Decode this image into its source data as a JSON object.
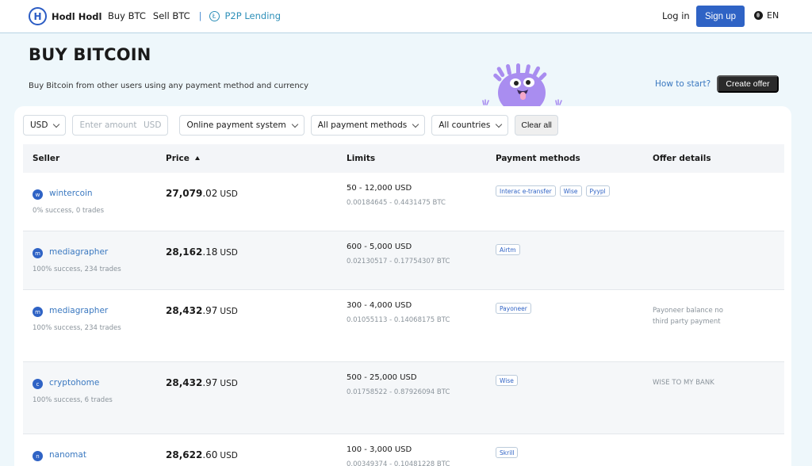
{
  "header": {
    "logo_text": "Hodl Hodl",
    "logo_letter": "H",
    "nav": [
      "Buy BTC",
      "Sell BTC"
    ],
    "separator": "|",
    "p2p_label": "P2P Lending",
    "p2p_icon_glyph": "Ł",
    "login": "Log in",
    "signup": "Sign up",
    "language": "EN"
  },
  "hero": {
    "title": "BUY BITCOIN",
    "subtitle": "Buy Bitcoin from other users using any payment method and currency",
    "how_to_start": "How to start?",
    "create_offer": "Create offer"
  },
  "filters": {
    "currency": "USD",
    "amount_placeholder": "Enter amount",
    "amount_currency": "USD",
    "payment_system": "Online payment system",
    "payment_methods": "All payment methods",
    "countries": "All countries",
    "clear": "Clear all"
  },
  "table": {
    "headers": {
      "seller": "Seller",
      "price": "Price",
      "limits": "Limits",
      "payment_methods": "Payment methods",
      "offer_details": "Offer details"
    },
    "rows": [
      {
        "avatar": "w",
        "seller": "wintercoin",
        "stats": "0% success, 0 trades",
        "price_int": "27,079",
        "price_dec": ".02",
        "currency": "USD",
        "limits": "50 - 12,000 USD",
        "btc": "0.00184645 - 0.4431475 BTC",
        "methods": [
          "Interac e-transfer",
          "Wise",
          "Pyypl"
        ],
        "details": ""
      },
      {
        "avatar": "m",
        "seller": "mediagrapher",
        "stats": "100% success, 234 trades",
        "price_int": "28,162",
        "price_dec": ".18",
        "currency": "USD",
        "limits": "600 - 5,000 USD",
        "btc": "0.02130517 - 0.17754307 BTC",
        "methods": [
          "Airtm"
        ],
        "details": ""
      },
      {
        "avatar": "m",
        "seller": "mediagrapher",
        "stats": "100% success, 234 trades",
        "price_int": "28,432",
        "price_dec": ".97",
        "currency": "USD",
        "limits": "300 - 4,000 USD",
        "btc": "0.01055113 - 0.14068175 BTC",
        "methods": [
          "Payoneer"
        ],
        "details": "Payoneer balance no third party payment"
      },
      {
        "avatar": "c",
        "seller": "cryptohome",
        "stats": "100% success, 6 trades",
        "price_int": "28,432",
        "price_dec": ".97",
        "currency": "USD",
        "limits": "500 - 25,000 USD",
        "btc": "0.01758522 - 0.87926094 BTC",
        "methods": [
          "Wise"
        ],
        "details": "WISE TO MY BANK"
      },
      {
        "avatar": "n",
        "seller": "nanomat",
        "stats": "",
        "price_int": "28,622",
        "price_dec": ".60",
        "currency": "USD",
        "limits": "100 - 3,000 USD",
        "btc": "0.00349374 - 0.10481228 BTC",
        "methods": [
          "Skrill"
        ],
        "details": ""
      }
    ]
  },
  "colors": {
    "accent": "#2f63c5",
    "link": "#3a78c0",
    "background": "#eef7fb",
    "mascot": "#a98df0"
  }
}
